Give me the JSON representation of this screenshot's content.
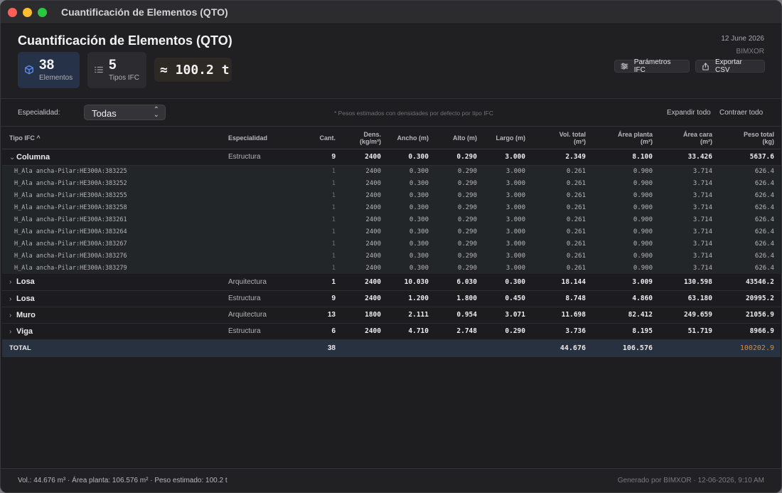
{
  "window": {
    "title": "Cuantificación de Elementos (QTO)"
  },
  "header": {
    "title": "Cuantificación de Elementos (QTO)",
    "date": "12 June 2026",
    "brand": "BIMXOR",
    "stats": [
      {
        "value": "38",
        "label": "Elementos",
        "icon": "cube-icon"
      },
      {
        "value": "5",
        "label": "Tipos IFC",
        "icon": "list-icon"
      },
      {
        "value": "≈ 100.2 t",
        "label": ""
      }
    ],
    "buttons": {
      "params": "Parámetros IFC",
      "export": "Exportar CSV"
    }
  },
  "filter": {
    "label": "Especialidad:",
    "selected": "Todas",
    "note": "* Pesos estimados con densidades por defecto por tipo IFC",
    "expand": "Expandir todo",
    "collapse": "Contraer todo"
  },
  "table": {
    "columns": [
      "Tipo IFC ^",
      "Especialidad",
      "Cant.",
      "Dens.\n(kg/m³)",
      "Ancho (m)",
      "Alto (m)",
      "Largo (m)",
      "Vol. total\n(m³)",
      "Área planta\n(m²)",
      "Área cara\n(m²)",
      "Peso total\n(kg)"
    ],
    "groups": [
      {
        "name": "Columna",
        "expanded": true,
        "especialidad": "Estructura",
        "values": [
          "9",
          "2400",
          "0.300",
          "0.290",
          "3.000",
          "2.349",
          "8.100",
          "33.426",
          "5637.6"
        ],
        "children": [
          {
            "name": "H_Ala ancha-Pilar:HE300A:383225",
            "values": [
              "1",
              "2400",
              "0.300",
              "0.290",
              "3.000",
              "0.261",
              "0.900",
              "3.714",
              "626.4"
            ]
          },
          {
            "name": "H_Ala ancha-Pilar:HE300A:383252",
            "values": [
              "1",
              "2400",
              "0.300",
              "0.290",
              "3.000",
              "0.261",
              "0.900",
              "3.714",
              "626.4"
            ]
          },
          {
            "name": "H_Ala ancha-Pilar:HE300A:383255",
            "values": [
              "1",
              "2400",
              "0.300",
              "0.290",
              "3.000",
              "0.261",
              "0.900",
              "3.714",
              "626.4"
            ]
          },
          {
            "name": "H_Ala ancha-Pilar:HE300A:383258",
            "values": [
              "1",
              "2400",
              "0.300",
              "0.290",
              "3.000",
              "0.261",
              "0.900",
              "3.714",
              "626.4"
            ]
          },
          {
            "name": "H_Ala ancha-Pilar:HE300A:383261",
            "values": [
              "1",
              "2400",
              "0.300",
              "0.290",
              "3.000",
              "0.261",
              "0.900",
              "3.714",
              "626.4"
            ]
          },
          {
            "name": "H_Ala ancha-Pilar:HE300A:383264",
            "values": [
              "1",
              "2400",
              "0.300",
              "0.290",
              "3.000",
              "0.261",
              "0.900",
              "3.714",
              "626.4"
            ]
          },
          {
            "name": "H_Ala ancha-Pilar:HE300A:383267",
            "values": [
              "1",
              "2400",
              "0.300",
              "0.290",
              "3.000",
              "0.261",
              "0.900",
              "3.714",
              "626.4"
            ]
          },
          {
            "name": "H_Ala ancha-Pilar:HE300A:383276",
            "values": [
              "1",
              "2400",
              "0.300",
              "0.290",
              "3.000",
              "0.261",
              "0.900",
              "3.714",
              "626.4"
            ]
          },
          {
            "name": "H_Ala ancha-Pilar:HE300A:383279",
            "values": [
              "1",
              "2400",
              "0.300",
              "0.290",
              "3.000",
              "0.261",
              "0.900",
              "3.714",
              "626.4"
            ]
          }
        ]
      },
      {
        "name": "Losa",
        "expanded": false,
        "especialidad": "Arquitectura",
        "values": [
          "1",
          "2400",
          "10.030",
          "6.030",
          "0.300",
          "18.144",
          "3.009",
          "130.598",
          "43546.2"
        ],
        "children": []
      },
      {
        "name": "Losa",
        "expanded": false,
        "especialidad": "Estructura",
        "values": [
          "9",
          "2400",
          "1.200",
          "1.800",
          "0.450",
          "8.748",
          "4.860",
          "63.180",
          "20995.2"
        ],
        "children": []
      },
      {
        "name": "Muro",
        "expanded": false,
        "especialidad": "Arquitectura",
        "values": [
          "13",
          "1800",
          "2.111",
          "0.954",
          "3.071",
          "11.698",
          "82.412",
          "249.659",
          "21056.9"
        ],
        "children": []
      },
      {
        "name": "Viga",
        "expanded": false,
        "especialidad": "Estructura",
        "values": [
          "6",
          "2400",
          "4.710",
          "2.748",
          "0.290",
          "3.736",
          "8.195",
          "51.719",
          "8966.9"
        ],
        "children": []
      }
    ],
    "total": {
      "label": "TOTAL",
      "count": "38",
      "volume": "44.676",
      "area_planta": "106.576",
      "weight": "100202.9"
    }
  },
  "footer": {
    "summary": "Vol.: 44.676 m³  ·  Área planta: 106.576 m²  ·  Peso estimado: 100.2 t",
    "generated": "Generado por BIMXOR · 12-06-2026, 9:10 AM"
  },
  "colors": {
    "accent": "#e0892e",
    "total_row": "#273140",
    "elements_card": "#263247"
  }
}
